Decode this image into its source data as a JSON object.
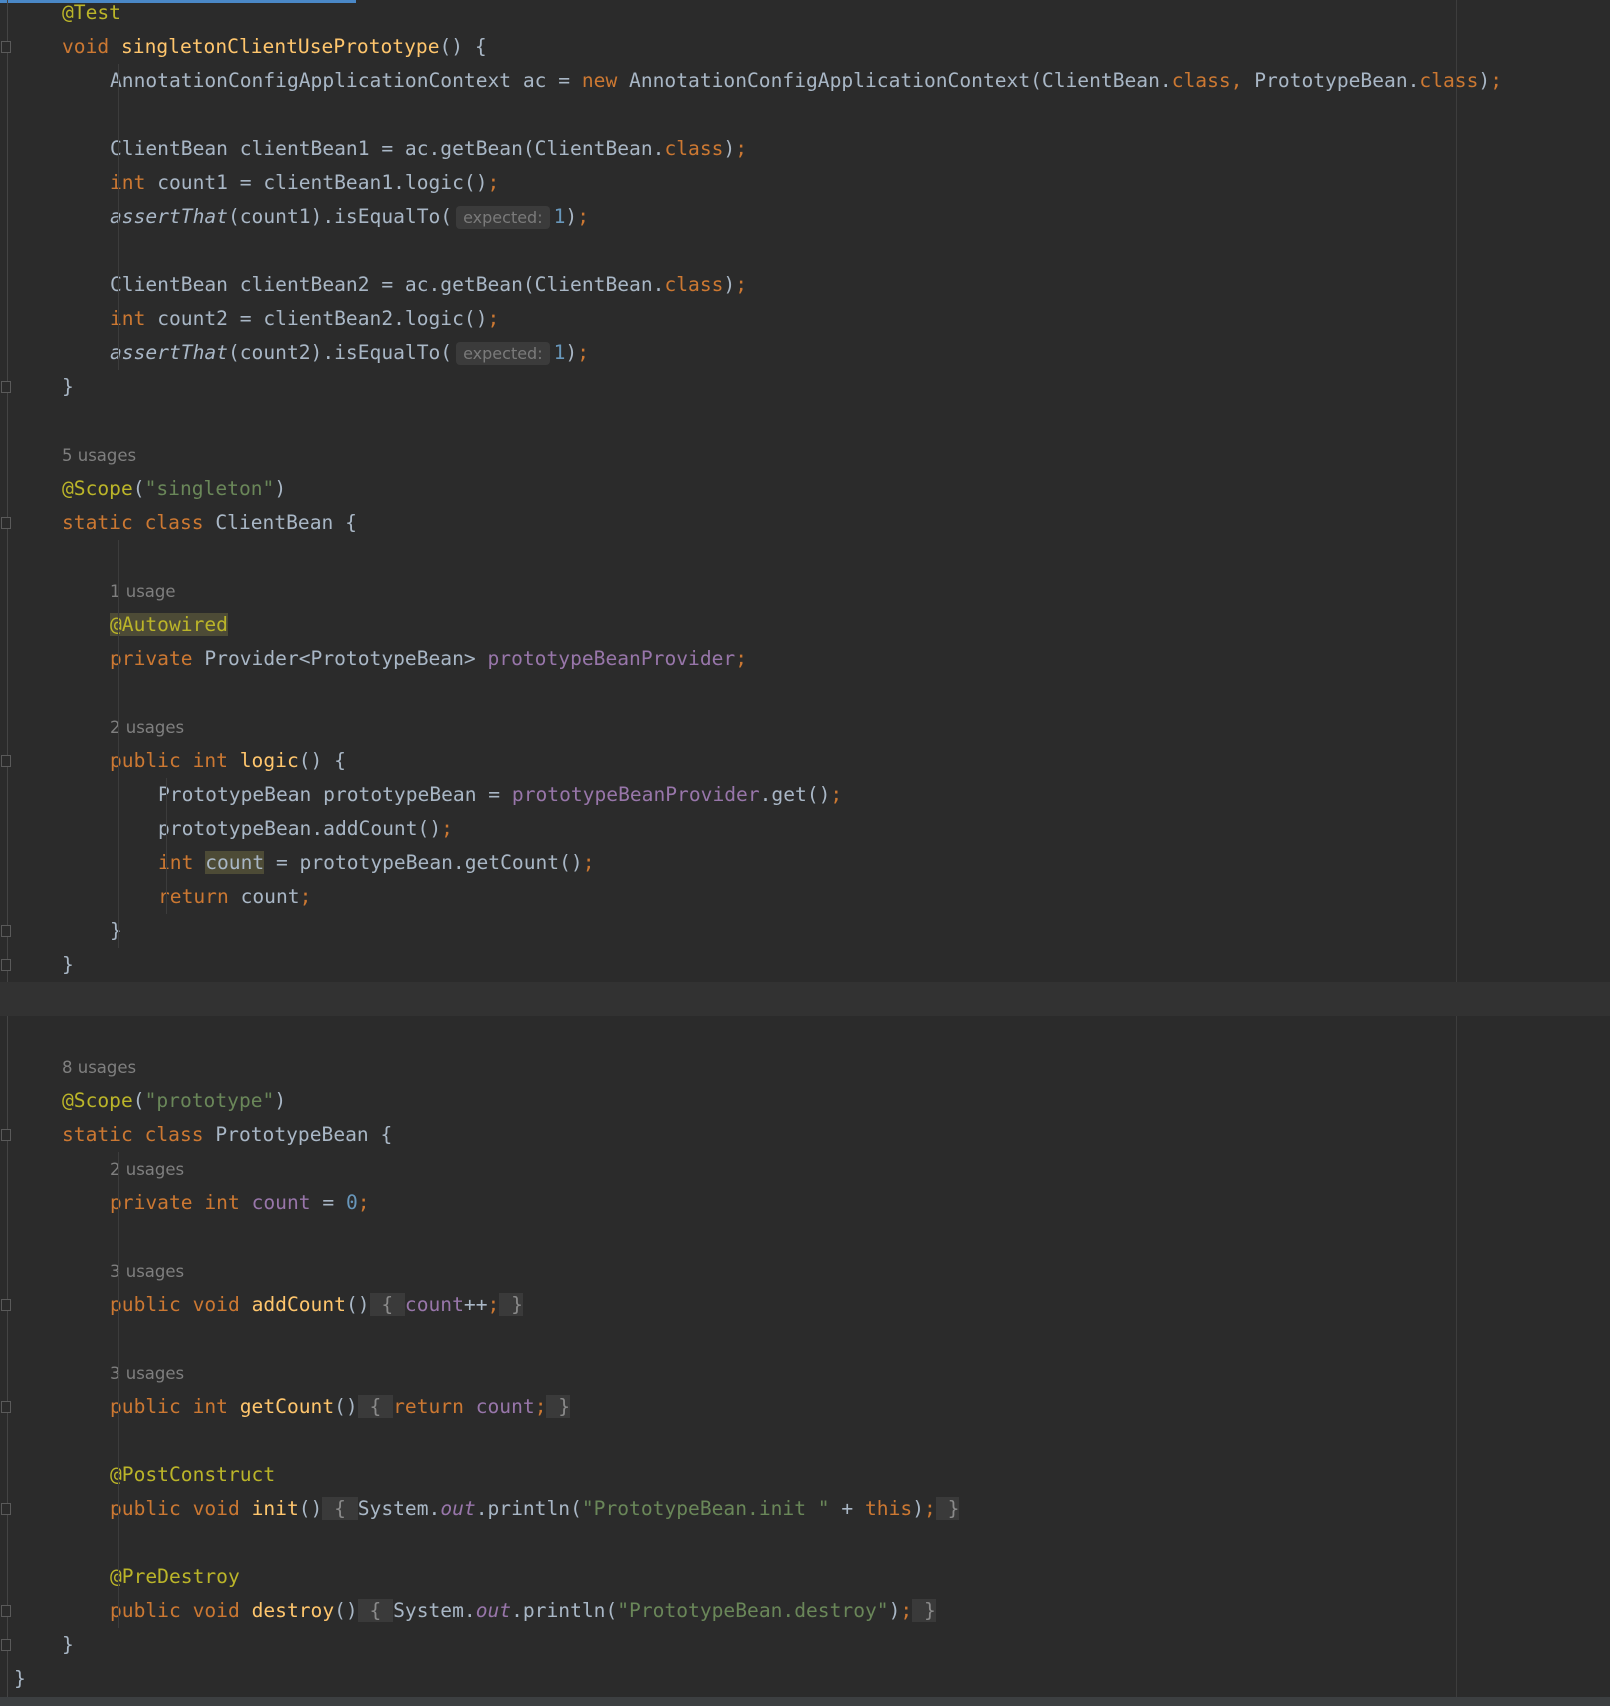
{
  "theme": {
    "background": "#2b2b2b",
    "keyword": "#cc7832",
    "function": "#ffc66d",
    "annotation": "#bbb529",
    "string": "#6a8759",
    "number": "#6897bb",
    "field": "#9876aa",
    "text": "#a9b7c6"
  },
  "editor": {
    "current_line": 29,
    "lines": [
      {
        "indent": 1,
        "fold": false,
        "tokens": [
          {
            "c": "a",
            "t": "@Test"
          }
        ]
      },
      {
        "indent": 1,
        "fold": true,
        "tokens": [
          {
            "c": "k",
            "t": "void "
          },
          {
            "c": "f",
            "t": "singletonClientUsePrototype"
          },
          {
            "c": "p",
            "t": "() {"
          }
        ]
      },
      {
        "indent": 2,
        "tokens": [
          {
            "c": "p",
            "t": "AnnotationConfigApplicationContext ac = "
          },
          {
            "c": "k",
            "t": "new "
          },
          {
            "c": "p",
            "t": "AnnotationConfigApplicationContext(ClientBean."
          },
          {
            "c": "k",
            "t": "class, "
          },
          {
            "c": "p",
            "t": "PrototypeBean."
          },
          {
            "c": "k",
            "t": "class"
          },
          {
            "c": "p",
            "t": ")"
          },
          {
            "c": "k",
            "t": ";"
          }
        ]
      },
      {
        "indent": 2,
        "tokens": []
      },
      {
        "indent": 2,
        "tokens": [
          {
            "c": "p",
            "t": "ClientBean clientBean1 = ac.getBean(ClientBean."
          },
          {
            "c": "k",
            "t": "class"
          },
          {
            "c": "p",
            "t": ")"
          },
          {
            "c": "k",
            "t": ";"
          }
        ]
      },
      {
        "indent": 2,
        "tokens": [
          {
            "c": "k",
            "t": "int "
          },
          {
            "c": "p",
            "t": "count1 = clientBean1.logic()"
          },
          {
            "c": "k",
            "t": ";"
          }
        ]
      },
      {
        "indent": 2,
        "tokens": [
          {
            "c": "i",
            "t": "assertThat"
          },
          {
            "c": "p",
            "t": "(count1).isEqualTo("
          },
          {
            "c": "h",
            "t": "expected:"
          },
          {
            "c": "n",
            "t": "1"
          },
          {
            "c": "p",
            "t": ")"
          },
          {
            "c": "k",
            "t": ";"
          }
        ]
      },
      {
        "indent": 2,
        "tokens": []
      },
      {
        "indent": 2,
        "tokens": [
          {
            "c": "p",
            "t": "ClientBean clientBean2 = ac.getBean(ClientBean."
          },
          {
            "c": "k",
            "t": "class"
          },
          {
            "c": "p",
            "t": ")"
          },
          {
            "c": "k",
            "t": ";"
          }
        ]
      },
      {
        "indent": 2,
        "tokens": [
          {
            "c": "k",
            "t": "int "
          },
          {
            "c": "p",
            "t": "count2 = clientBean2.logic()"
          },
          {
            "c": "k",
            "t": ";"
          }
        ]
      },
      {
        "indent": 2,
        "tokens": [
          {
            "c": "i",
            "t": "assertThat"
          },
          {
            "c": "p",
            "t": "(count2).isEqualTo("
          },
          {
            "c": "h",
            "t": "expected:"
          },
          {
            "c": "n",
            "t": "1"
          },
          {
            "c": "p",
            "t": ")"
          },
          {
            "c": "k",
            "t": ";"
          }
        ]
      },
      {
        "indent": 1,
        "fold": true,
        "tokens": [
          {
            "c": "p",
            "t": "}"
          }
        ]
      },
      {
        "indent": 1,
        "tokens": []
      },
      {
        "indent": 1,
        "tokens": [
          {
            "c": "u",
            "t": "5 usages"
          }
        ]
      },
      {
        "indent": 1,
        "tokens": [
          {
            "c": "a",
            "t": "@Scope"
          },
          {
            "c": "p",
            "t": "("
          },
          {
            "c": "s",
            "t": "\"singleton\""
          },
          {
            "c": "p",
            "t": ")"
          }
        ]
      },
      {
        "indent": 1,
        "fold": true,
        "tokens": [
          {
            "c": "k",
            "t": "static class "
          },
          {
            "c": "p",
            "t": "ClientBean {"
          }
        ]
      },
      {
        "indent": 2,
        "tokens": []
      },
      {
        "indent": 2,
        "tokens": [
          {
            "c": "u",
            "t": "1 usage"
          }
        ]
      },
      {
        "indent": 2,
        "tokens": [
          {
            "c": "ahl",
            "t": "@Autowired"
          }
        ]
      },
      {
        "indent": 2,
        "tokens": [
          {
            "c": "k",
            "t": "private "
          },
          {
            "c": "p",
            "t": "Provider<PrototypeBean> "
          },
          {
            "c": "v",
            "t": "prototypeBeanProvider"
          },
          {
            "c": "k",
            "t": ";"
          }
        ]
      },
      {
        "indent": 2,
        "tokens": []
      },
      {
        "indent": 2,
        "tokens": [
          {
            "c": "u",
            "t": "2 usages"
          }
        ]
      },
      {
        "indent": 2,
        "fold": true,
        "tokens": [
          {
            "c": "k",
            "t": "public int "
          },
          {
            "c": "f",
            "t": "logic"
          },
          {
            "c": "p",
            "t": "() {"
          }
        ]
      },
      {
        "indent": 3,
        "tokens": [
          {
            "c": "p",
            "t": "PrototypeBean prototypeBean = "
          },
          {
            "c": "v",
            "t": "prototypeBeanProvider"
          },
          {
            "c": "p",
            "t": ".get()"
          },
          {
            "c": "k",
            "t": ";"
          }
        ]
      },
      {
        "indent": 3,
        "tokens": [
          {
            "c": "p",
            "t": "prototypeBean.addCount()"
          },
          {
            "c": "k",
            "t": ";"
          }
        ]
      },
      {
        "indent": 3,
        "tokens": [
          {
            "c": "k",
            "t": "int "
          },
          {
            "c": "hl",
            "t": "count"
          },
          {
            "c": "p",
            "t": " = prototypeBean.getCount()"
          },
          {
            "c": "k",
            "t": ";"
          }
        ]
      },
      {
        "indent": 3,
        "tokens": [
          {
            "c": "k",
            "t": "return "
          },
          {
            "c": "p",
            "t": "count"
          },
          {
            "c": "k",
            "t": ";"
          }
        ]
      },
      {
        "indent": 2,
        "fold": true,
        "tokens": [
          {
            "c": "p",
            "t": "}"
          }
        ]
      },
      {
        "indent": 1,
        "fold": true,
        "tokens": [
          {
            "c": "p",
            "t": "}"
          }
        ]
      },
      {
        "indent": 1,
        "tokens": []
      },
      {
        "indent": 1,
        "tokens": []
      },
      {
        "indent": 1,
        "tokens": [
          {
            "c": "u",
            "t": "8 usages"
          }
        ]
      },
      {
        "indent": 1,
        "tokens": [
          {
            "c": "a",
            "t": "@Scope"
          },
          {
            "c": "p",
            "t": "("
          },
          {
            "c": "s",
            "t": "\"prototype\""
          },
          {
            "c": "p",
            "t": ")"
          }
        ]
      },
      {
        "indent": 1,
        "fold": true,
        "tokens": [
          {
            "c": "k",
            "t": "static class "
          },
          {
            "c": "p",
            "t": "PrototypeBean {"
          }
        ]
      },
      {
        "indent": 2,
        "tokens": [
          {
            "c": "u",
            "t": "2 usages"
          }
        ]
      },
      {
        "indent": 2,
        "tokens": [
          {
            "c": "k",
            "t": "private int "
          },
          {
            "c": "v",
            "t": "count"
          },
          {
            "c": "p",
            "t": " = "
          },
          {
            "c": "n",
            "t": "0"
          },
          {
            "c": "k",
            "t": ";"
          }
        ]
      },
      {
        "indent": 2,
        "tokens": []
      },
      {
        "indent": 2,
        "tokens": [
          {
            "c": "u",
            "t": "3 usages"
          }
        ]
      },
      {
        "indent": 2,
        "fold": true,
        "tokens": [
          {
            "c": "k",
            "t": "public void "
          },
          {
            "c": "f",
            "t": "addCount"
          },
          {
            "c": "p",
            "t": "()"
          },
          {
            "c": "fold",
            "t": " { "
          },
          {
            "c": "v",
            "t": "count"
          },
          {
            "c": "p",
            "t": "++"
          },
          {
            "c": "k",
            "t": ";"
          },
          {
            "c": "fold",
            "t": " }"
          }
        ]
      },
      {
        "indent": 2,
        "tokens": []
      },
      {
        "indent": 2,
        "tokens": [
          {
            "c": "u",
            "t": "3 usages"
          }
        ]
      },
      {
        "indent": 2,
        "fold": true,
        "tokens": [
          {
            "c": "k",
            "t": "public int "
          },
          {
            "c": "f",
            "t": "getCount"
          },
          {
            "c": "p",
            "t": "()"
          },
          {
            "c": "fold",
            "t": " { "
          },
          {
            "c": "k",
            "t": "return "
          },
          {
            "c": "v",
            "t": "count"
          },
          {
            "c": "k",
            "t": ";"
          },
          {
            "c": "fold",
            "t": " }"
          }
        ]
      },
      {
        "indent": 2,
        "tokens": []
      },
      {
        "indent": 2,
        "tokens": [
          {
            "c": "a",
            "t": "@PostConstruct"
          }
        ]
      },
      {
        "indent": 2,
        "fold": true,
        "tokens": [
          {
            "c": "k",
            "t": "public void "
          },
          {
            "c": "f",
            "t": "init"
          },
          {
            "c": "p",
            "t": "()"
          },
          {
            "c": "fold",
            "t": " { "
          },
          {
            "c": "p",
            "t": "System."
          },
          {
            "c": "iv",
            "t": "out"
          },
          {
            "c": "p",
            "t": ".println("
          },
          {
            "c": "s",
            "t": "\"PrototypeBean.init \""
          },
          {
            "c": "p",
            "t": " + "
          },
          {
            "c": "k",
            "t": "this"
          },
          {
            "c": "p",
            "t": ")"
          },
          {
            "c": "k",
            "t": ";"
          },
          {
            "c": "fold",
            "t": " }"
          }
        ]
      },
      {
        "indent": 2,
        "tokens": []
      },
      {
        "indent": 2,
        "tokens": [
          {
            "c": "a",
            "t": "@PreDestroy"
          }
        ]
      },
      {
        "indent": 2,
        "fold": true,
        "tokens": [
          {
            "c": "k",
            "t": "public void "
          },
          {
            "c": "f",
            "t": "destroy"
          },
          {
            "c": "p",
            "t": "()"
          },
          {
            "c": "fold",
            "t": " { "
          },
          {
            "c": "p",
            "t": "System."
          },
          {
            "c": "iv",
            "t": "out"
          },
          {
            "c": "p",
            "t": ".println("
          },
          {
            "c": "s",
            "t": "\"PrototypeBean.destroy\""
          },
          {
            "c": "p",
            "t": ")"
          },
          {
            "c": "k",
            "t": ";"
          },
          {
            "c": "fold",
            "t": " }"
          }
        ]
      },
      {
        "indent": 1,
        "fold": true,
        "tokens": [
          {
            "c": "p",
            "t": "}"
          }
        ]
      },
      {
        "indent": 0,
        "tokens": [
          {
            "c": "p",
            "t": "}"
          }
        ]
      }
    ]
  }
}
